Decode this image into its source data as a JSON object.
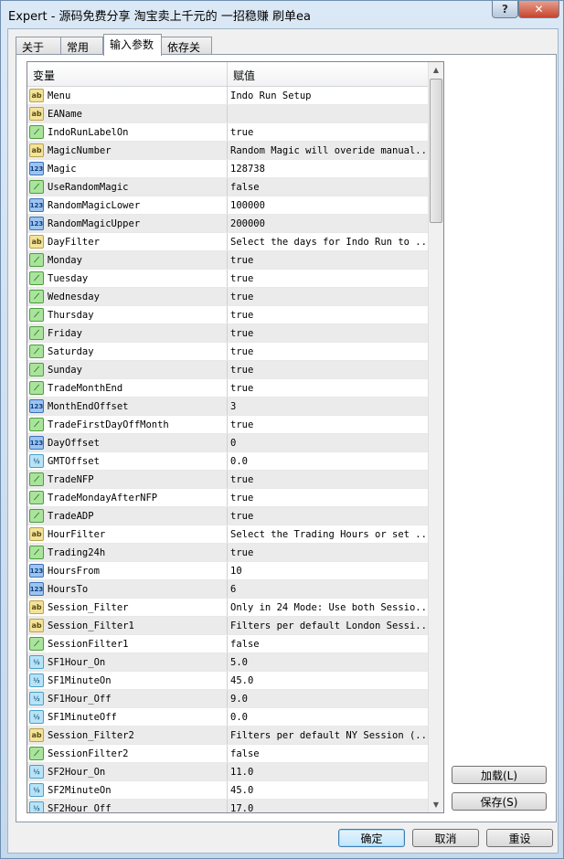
{
  "window": {
    "title": "Expert - 源码免费分享 淘宝卖上千元的 一招稳赚 刷单ea",
    "help": "?",
    "close": "✕"
  },
  "tabs": [
    {
      "label": "关于"
    },
    {
      "label": "常用"
    },
    {
      "label": "输入参数",
      "active": true
    },
    {
      "label": "依存关系"
    }
  ],
  "table": {
    "headers": [
      "变量",
      "赋值"
    ],
    "rows": [
      {
        "type": "s",
        "name": "Menu",
        "value": "Indo Run Setup"
      },
      {
        "type": "s",
        "name": "EAName",
        "value": ""
      },
      {
        "type": "b",
        "name": "IndoRunLabelOn",
        "value": "true"
      },
      {
        "type": "s",
        "name": "MagicNumber",
        "value": "Random Magic will overide manual..."
      },
      {
        "type": "i",
        "name": "Magic",
        "value": "128738"
      },
      {
        "type": "b",
        "name": "UseRandomMagic",
        "value": "false"
      },
      {
        "type": "i",
        "name": "RandomMagicLower",
        "value": "100000"
      },
      {
        "type": "i",
        "name": "RandomMagicUpper",
        "value": "200000"
      },
      {
        "type": "s",
        "name": "DayFilter",
        "value": "Select the days for Indo Run to ..."
      },
      {
        "type": "b",
        "name": "Monday",
        "value": "true"
      },
      {
        "type": "b",
        "name": "Tuesday",
        "value": "true"
      },
      {
        "type": "b",
        "name": "Wednesday",
        "value": "true"
      },
      {
        "type": "b",
        "name": "Thursday",
        "value": "true"
      },
      {
        "type": "b",
        "name": "Friday",
        "value": "true"
      },
      {
        "type": "b",
        "name": "Saturday",
        "value": "true"
      },
      {
        "type": "b",
        "name": "Sunday",
        "value": "true"
      },
      {
        "type": "b",
        "name": "TradeMonthEnd",
        "value": "true"
      },
      {
        "type": "i",
        "name": "MonthEndOffset",
        "value": "3"
      },
      {
        "type": "b",
        "name": "TradeFirstDayOffMonth",
        "value": "true"
      },
      {
        "type": "i",
        "name": "DayOffset",
        "value": "0"
      },
      {
        "type": "d",
        "name": "GMTOffset",
        "value": "0.0"
      },
      {
        "type": "b",
        "name": "TradeNFP",
        "value": "true"
      },
      {
        "type": "b",
        "name": "TradeMondayAfterNFP",
        "value": "true"
      },
      {
        "type": "b",
        "name": "TradeADP",
        "value": "true"
      },
      {
        "type": "s",
        "name": "HourFilter",
        "value": "Select the Trading Hours or set ..."
      },
      {
        "type": "b",
        "name": "Trading24h",
        "value": "true"
      },
      {
        "type": "i",
        "name": "HoursFrom",
        "value": "10"
      },
      {
        "type": "i",
        "name": "HoursTo",
        "value": "6"
      },
      {
        "type": "s",
        "name": "Session_Filter",
        "value": "Only in 24 Mode: Use both Sessio..."
      },
      {
        "type": "s",
        "name": "Session_Filter1",
        "value": "Filters per default London Sessi..."
      },
      {
        "type": "b",
        "name": "SessionFilter1",
        "value": "false"
      },
      {
        "type": "d",
        "name": "SF1Hour_On",
        "value": "5.0"
      },
      {
        "type": "d",
        "name": "SF1MinuteOn",
        "value": "45.0"
      },
      {
        "type": "d",
        "name": "SF1Hour_Off",
        "value": "9.0"
      },
      {
        "type": "d",
        "name": "SF1MinuteOff",
        "value": "0.0"
      },
      {
        "type": "s",
        "name": "Session_Filter2",
        "value": "Filters per default NY Session (..."
      },
      {
        "type": "b",
        "name": "SessionFilter2",
        "value": "false"
      },
      {
        "type": "d",
        "name": "SF2Hour_On",
        "value": "11.0"
      },
      {
        "type": "d",
        "name": "SF2MinuteOn",
        "value": "45.0"
      },
      {
        "type": "d",
        "name": "SF2Hour_Off",
        "value": "17.0"
      }
    ]
  },
  "icons": {
    "s": "ab",
    "b": "⟋",
    "i": "123",
    "d": "½"
  },
  "buttons": {
    "load": "加载(L)",
    "save": "保存(S)",
    "ok": "确定",
    "cancel": "取消",
    "reset": "重设"
  }
}
